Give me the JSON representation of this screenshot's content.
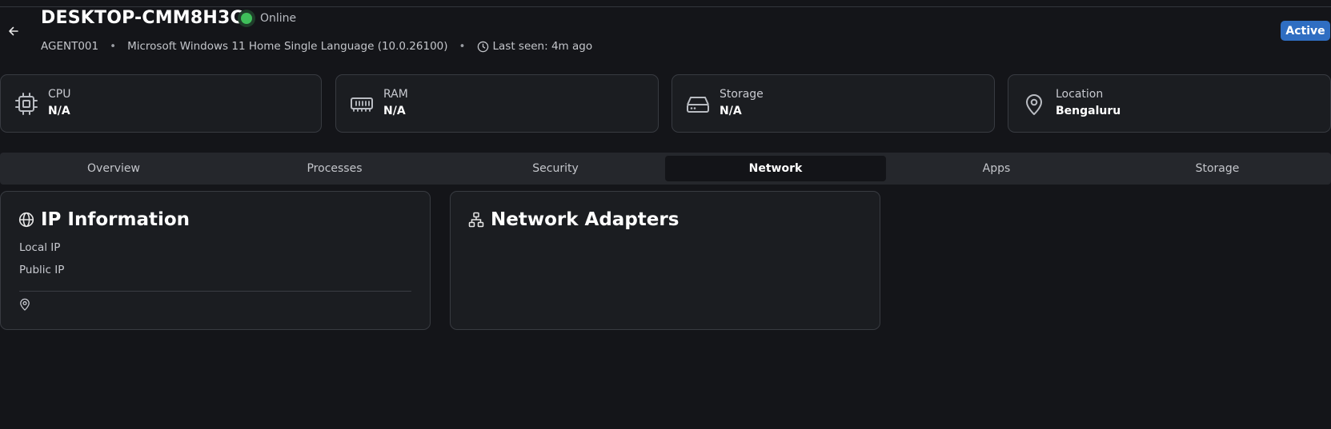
{
  "header": {
    "title": "DESKTOP-CMM8H3C",
    "status": "Online",
    "agent_id": "AGENT001",
    "os": "Microsoft Windows 11 Home Single Language (10.0.26100)",
    "last_seen": "Last seen: 4m ago",
    "badge": "Active",
    "separator": "•"
  },
  "stats": [
    {
      "label": "CPU",
      "value": "N/A",
      "icon": "cpu-icon"
    },
    {
      "label": "RAM",
      "value": "N/A",
      "icon": "ram-icon"
    },
    {
      "label": "Storage",
      "value": "N/A",
      "icon": "storage-icon"
    },
    {
      "label": "Location",
      "value": "Bengaluru",
      "icon": "location-pin-icon"
    }
  ],
  "tabs": [
    "Overview",
    "Processes",
    "Security",
    "Network",
    "Apps",
    "Storage"
  ],
  "active_tab": "Network",
  "ip_card": {
    "title": "IP Information",
    "local_ip_label": "Local IP",
    "public_ip_label": "Public IP"
  },
  "adapters_card": {
    "title": "Network Adapters"
  },
  "colors": {
    "background": "#141519",
    "card": "#1b1d21",
    "online": "#3fbf5a",
    "badge": "#2f6ec2"
  }
}
